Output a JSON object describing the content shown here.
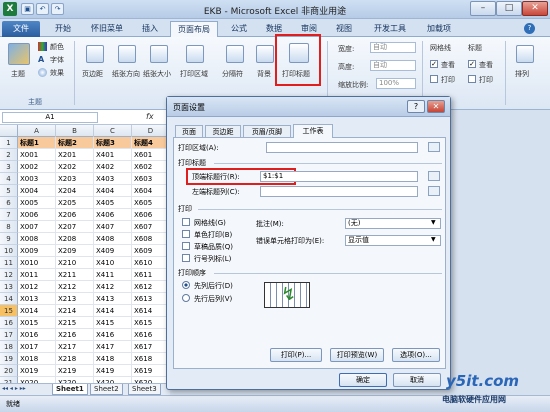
{
  "window": {
    "title": "EKB - Microsoft Excel 非商业用途",
    "qa_icons": [
      "save-icon",
      "undo-icon",
      "redo-icon"
    ]
  },
  "tabs": [
    "文件",
    "开始",
    "怀旧菜单",
    "插入",
    "页面布局",
    "公式",
    "数据",
    "审阅",
    "视图",
    "开发工具",
    "加载项"
  ],
  "ribbon": {
    "theme": {
      "big": "主题",
      "items": [
        "颜色",
        "字体",
        "效果"
      ],
      "group": "主题"
    },
    "page_buttons": [
      "页边距",
      "纸张方向",
      "纸张大小",
      "打印区域",
      "分隔符",
      "背景",
      "打印标题"
    ],
    "scale": {
      "width_label": "宽度:",
      "width_val": "自动",
      "height_label": "高度:",
      "height_val": "自动",
      "scale_label": "缩放比例:",
      "scale_val": "100%"
    },
    "sheet_options": {
      "gridlines": "网格线",
      "headings": "标题",
      "view": "查看",
      "print": "打印"
    },
    "arrange": "排列"
  },
  "formula_bar": {
    "name_box": "A1",
    "fx": "fx"
  },
  "sheet": {
    "columns": [
      "A",
      "B",
      "C",
      "D"
    ],
    "header_row": [
      "标题1",
      "标题2",
      "标题3",
      "标题4"
    ],
    "rows": [
      [
        "X001",
        "X201",
        "X401",
        "X601"
      ],
      [
        "X002",
        "X202",
        "X402",
        "X602"
      ],
      [
        "X003",
        "X203",
        "X403",
        "X603"
      ],
      [
        "X004",
        "X204",
        "X404",
        "X604"
      ],
      [
        "X005",
        "X205",
        "X405",
        "X605"
      ],
      [
        "X006",
        "X206",
        "X406",
        "X606"
      ],
      [
        "X007",
        "X207",
        "X407",
        "X607"
      ],
      [
        "X008",
        "X208",
        "X408",
        "X608"
      ],
      [
        "X009",
        "X209",
        "X409",
        "X609"
      ],
      [
        "X010",
        "X210",
        "X410",
        "X610"
      ],
      [
        "X011",
        "X211",
        "X411",
        "X611"
      ],
      [
        "X012",
        "X212",
        "X412",
        "X612"
      ],
      [
        "X013",
        "X213",
        "X413",
        "X613"
      ],
      [
        "X014",
        "X214",
        "X414",
        "X614"
      ],
      [
        "X015",
        "X215",
        "X415",
        "X615"
      ],
      [
        "X016",
        "X216",
        "X416",
        "X616"
      ],
      [
        "X017",
        "X217",
        "X417",
        "X617"
      ],
      [
        "X018",
        "X218",
        "X418",
        "X618"
      ],
      [
        "X019",
        "X219",
        "X419",
        "X619"
      ],
      [
        "X020",
        "X220",
        "X420",
        "X620"
      ]
    ],
    "tabs": [
      "Sheet1",
      "Sheet2",
      "Sheet3"
    ]
  },
  "status": {
    "ready": "就绪"
  },
  "dialog": {
    "title": "页面设置",
    "tabs": [
      "页面",
      "页边距",
      "页眉/页脚",
      "工作表"
    ],
    "print_area": "打印区域(A):",
    "print_titles": "打印标题",
    "top_rows": "顶端标题行(R):",
    "top_rows_value": "$1:$1",
    "left_cols": "左端标题列(C):",
    "print_section": "打印",
    "gridlines": "网格线(G)",
    "mono": "单色打印(B)",
    "draft": "草稿品质(Q)",
    "row_col": "行号列标(L)",
    "comments_label": "批注(M):",
    "comments_value": "(无)",
    "errors_label": "错误单元格打印为(E):",
    "errors_value": "显示值",
    "order_section": "打印顺序",
    "down_then_over": "先列后行(D)",
    "over_then_down": "先行后列(V)",
    "print_btn": "打印(P)...",
    "preview_btn": "打印预览(W)",
    "options_btn": "选项(O)...",
    "ok_btn": "确定",
    "cancel_btn": "取消"
  },
  "watermark": {
    "logo": "y5it.com",
    "sub": "电脑软硬件应用网"
  },
  "colors": {
    "highlight": "#e01e1e",
    "header_fill": "#f8c99b"
  }
}
